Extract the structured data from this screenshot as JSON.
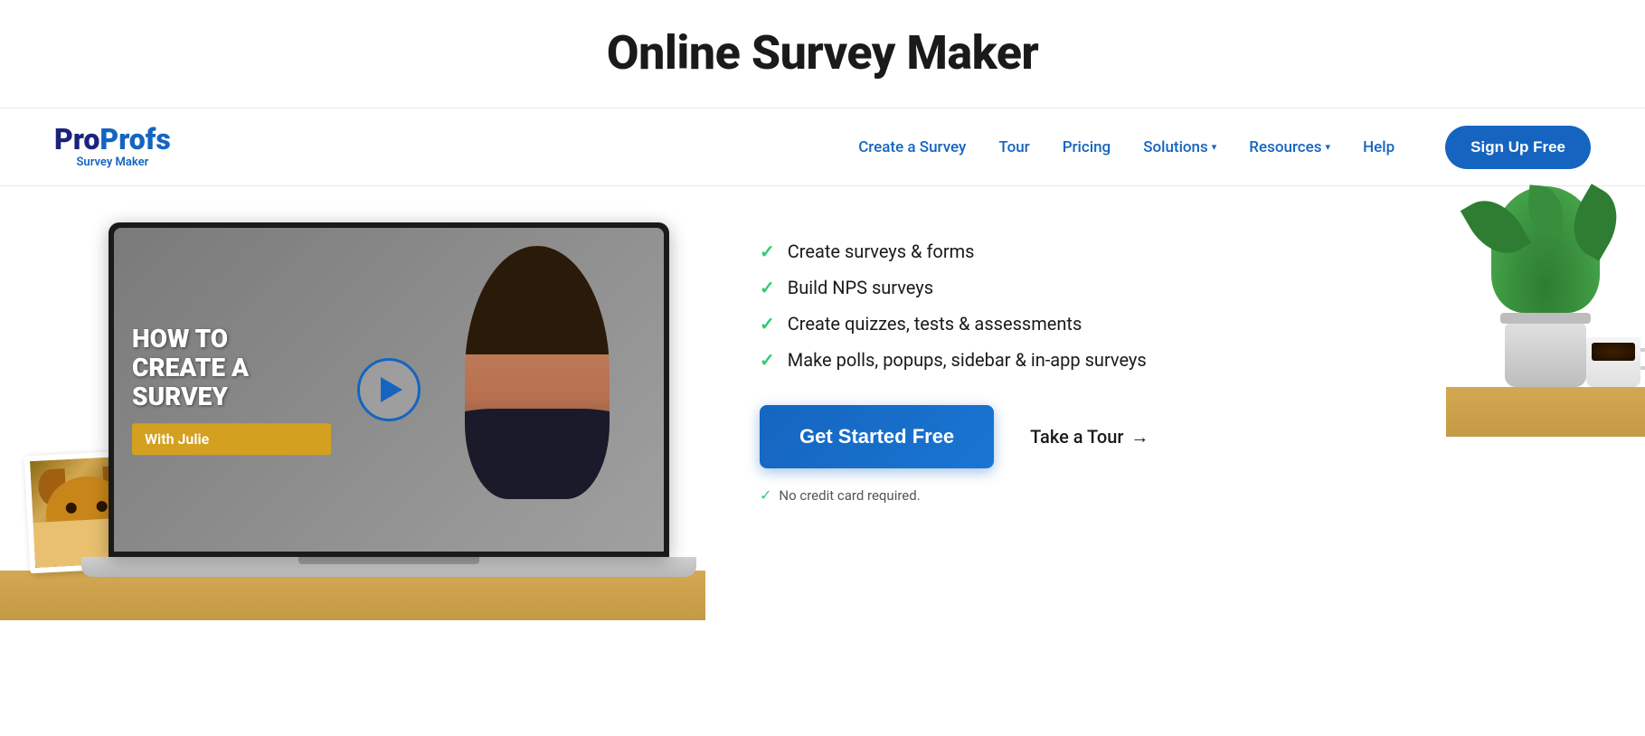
{
  "page": {
    "top_title": "Online Survey Maker"
  },
  "navbar": {
    "logo_pro": "Pro",
    "logo_profs": "Profs",
    "logo_subtitle": "Survey Maker",
    "links": [
      {
        "id": "create-survey",
        "label": "Create a Survey"
      },
      {
        "id": "tour",
        "label": "Tour"
      },
      {
        "id": "pricing",
        "label": "Pricing"
      },
      {
        "id": "solutions",
        "label": "Solutions",
        "has_dropdown": true
      },
      {
        "id": "resources",
        "label": "Resources",
        "has_dropdown": true
      },
      {
        "id": "help",
        "label": "Help"
      }
    ],
    "signup_label": "Sign Up Free"
  },
  "hero": {
    "video": {
      "title_line1": "HOW TO",
      "title_line2": "CREATE A",
      "title_line3": "SURVEY",
      "subtitle": "With Julie"
    },
    "features": [
      {
        "id": "feature-1",
        "text": "Create surveys & forms"
      },
      {
        "id": "feature-2",
        "text": "Build NPS surveys"
      },
      {
        "id": "feature-3",
        "text": "Create quizzes, tests & assessments"
      },
      {
        "id": "feature-4",
        "text": "Make polls, popups, sidebar & in-app surveys"
      }
    ],
    "cta": {
      "get_started_label": "Get Started Free",
      "tour_label": "Take a Tour",
      "tour_arrow": "→",
      "no_card_text": "No credit card required."
    }
  }
}
